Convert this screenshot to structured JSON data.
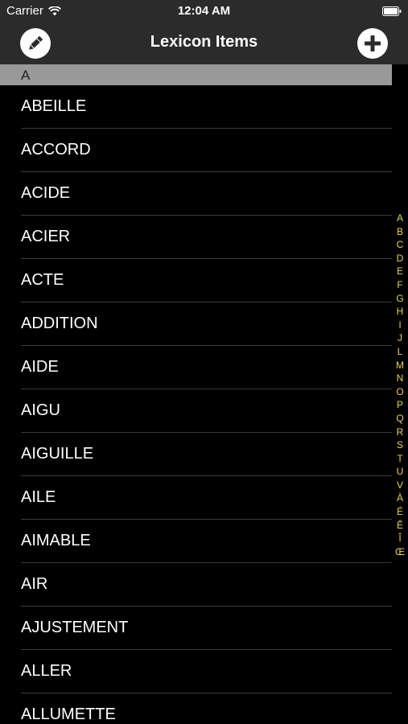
{
  "status_bar": {
    "carrier": "Carrier",
    "time": "12:04 AM"
  },
  "nav_bar": {
    "title": "Lexicon Items",
    "left_icon": "pencil-icon",
    "right_icon": "plus-icon"
  },
  "colors": {
    "background": "#000000",
    "bar": "#2b2b2b",
    "section_header": "#999999",
    "index_letters": "#e8d44d"
  },
  "list": {
    "section": "A",
    "items": [
      "ABEILLE",
      "ACCORD",
      "ACIDE",
      "ACIER",
      "ACTE",
      "ADDITION",
      "AIDE",
      "AIGU",
      "AIGUILLE",
      "AILE",
      "AIMABLE",
      "AIR",
      "AJUSTEMENT",
      "ALLER",
      "ALLUMETTE"
    ]
  },
  "index": [
    "A",
    "B",
    "C",
    "D",
    "E",
    "F",
    "G",
    "H",
    "I",
    "J",
    "L",
    "M",
    "N",
    "O",
    "P",
    "Q",
    "R",
    "S",
    "T",
    "U",
    "V",
    "À",
    "É",
    "Ê",
    "Î",
    "Œ"
  ]
}
